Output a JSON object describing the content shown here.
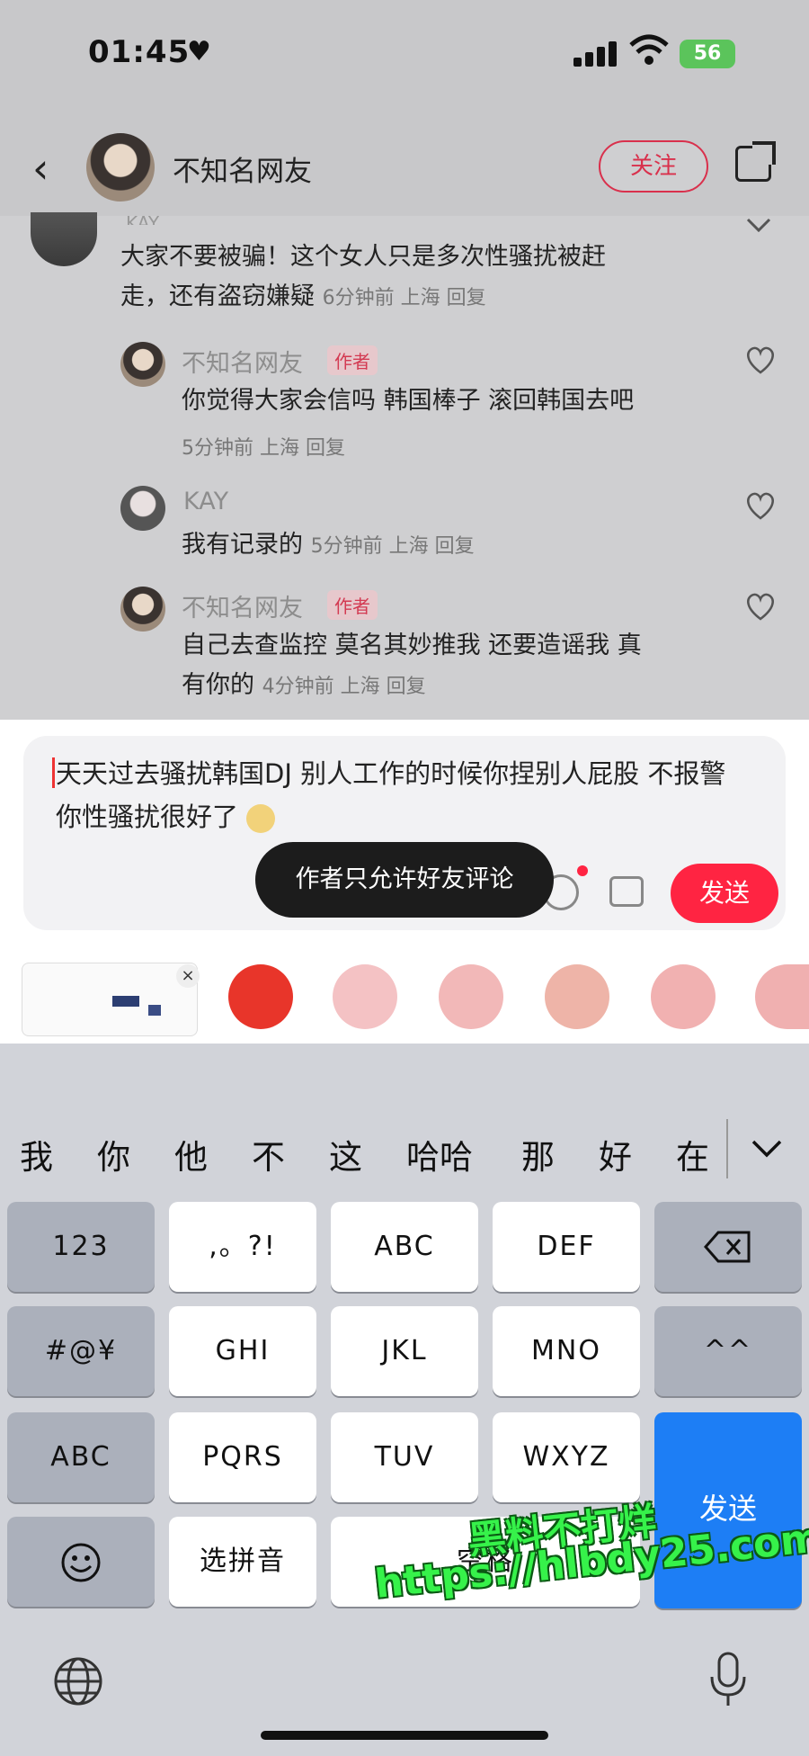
{
  "status": {
    "time": "01:45",
    "battery": "56"
  },
  "header": {
    "name": "不知名网友",
    "follow_label": "关注"
  },
  "comments": {
    "partial_name": "KAY",
    "top_text_line1": "大家不要被骗！这个女人只是多次性骚扰被赶",
    "top_text_line2": "走，还有盗窃嫌疑",
    "top_meta": "6分钟前 上海 回复",
    "replies": [
      {
        "name": "不知名网友",
        "tag": "作者",
        "text": "你觉得大家会信吗 韩国棒子 滚回韩国去吧",
        "meta": "5分钟前 上海 回复"
      },
      {
        "name": "KAY",
        "text": "我有记录的",
        "meta": "5分钟前 上海 回复"
      },
      {
        "name": "不知名网友",
        "tag": "作者",
        "text_line1": "自己去查监控 莫名其妙推我 还要造谣我 真",
        "text_line2": "有你的",
        "meta": "4分钟前 上海 回复"
      }
    ]
  },
  "input": {
    "text_line1": "天天过去骚扰韩国DJ 别人工作的时候你捏别人屁股 不报警",
    "text_line2": "你性骚扰很好了",
    "toast": "作者只允许好友评论",
    "send_label": "发送"
  },
  "keyboard": {
    "candidates": [
      "我",
      "你",
      "他",
      "不",
      "这",
      "哈哈",
      "那",
      "好",
      "在"
    ],
    "rows": [
      [
        "123",
        ",。?!",
        "ABC",
        "DEF"
      ],
      [
        "#@¥",
        "GHI",
        "JKL",
        "MNO",
        "^^"
      ],
      [
        "ABC",
        "PQRS",
        "TUV",
        "WXYZ"
      ],
      [
        "选拼音",
        "空格"
      ]
    ],
    "enter_label": "发送"
  },
  "watermark": {
    "line1": "黑料不打烊",
    "line2": "https://hlbdy25.com"
  },
  "colors": {
    "accent": "#ff2442",
    "enter": "#1d7ef5"
  }
}
